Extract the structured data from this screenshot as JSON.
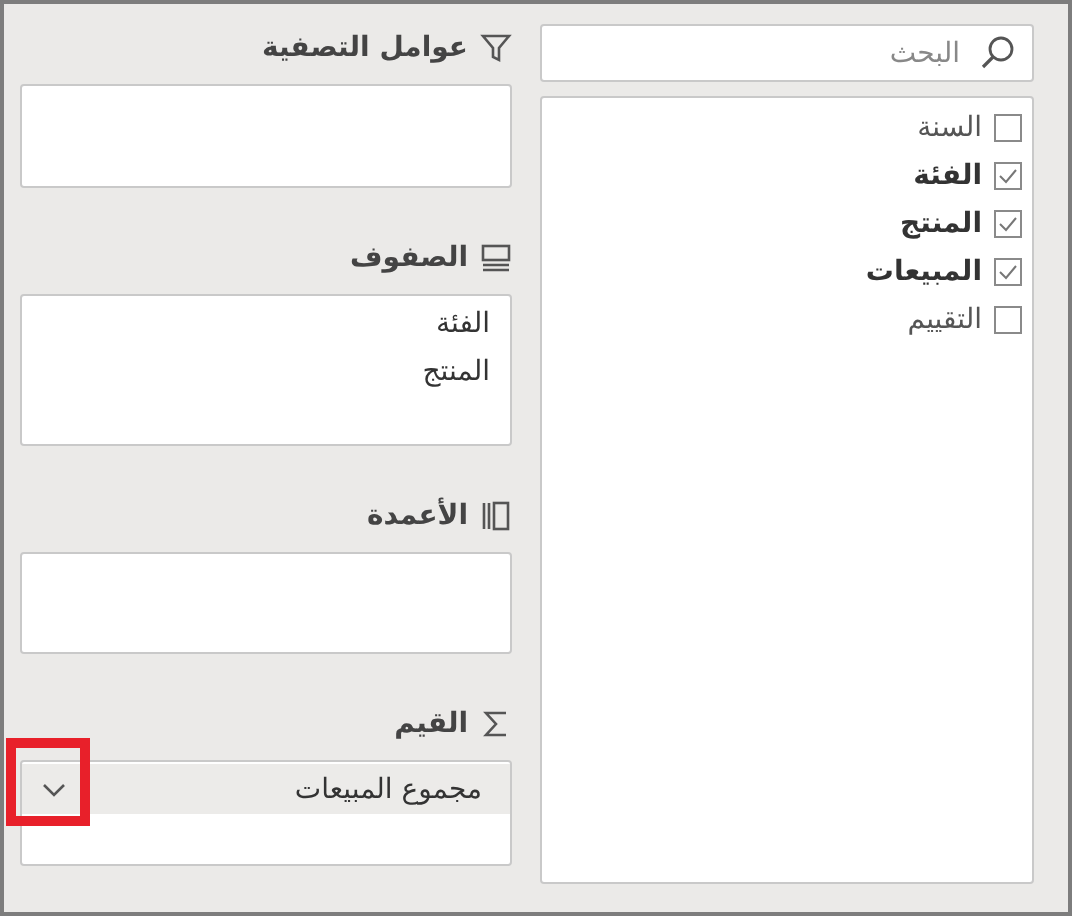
{
  "search": {
    "placeholder": "البحث"
  },
  "fields": [
    {
      "label": "السنة",
      "checked": false
    },
    {
      "label": "الفئة",
      "checked": true
    },
    {
      "label": "المنتج",
      "checked": true
    },
    {
      "label": "المبيعات",
      "checked": true
    },
    {
      "label": "التقييم",
      "checked": false
    }
  ],
  "areas": [
    {
      "kind": "filters",
      "title": "عوامل التصفية"
    },
    {
      "kind": "rows",
      "title": "الصفوف",
      "items": [
        {
          "label": "الفئة"
        },
        {
          "label": "المنتج"
        }
      ]
    },
    {
      "kind": "columns",
      "title": "الأعمدة"
    },
    {
      "kind": "values",
      "title": "القيم",
      "items": [
        {
          "label": "مجموع المبيعات",
          "dropdown": true,
          "highlighted": true
        }
      ]
    }
  ]
}
